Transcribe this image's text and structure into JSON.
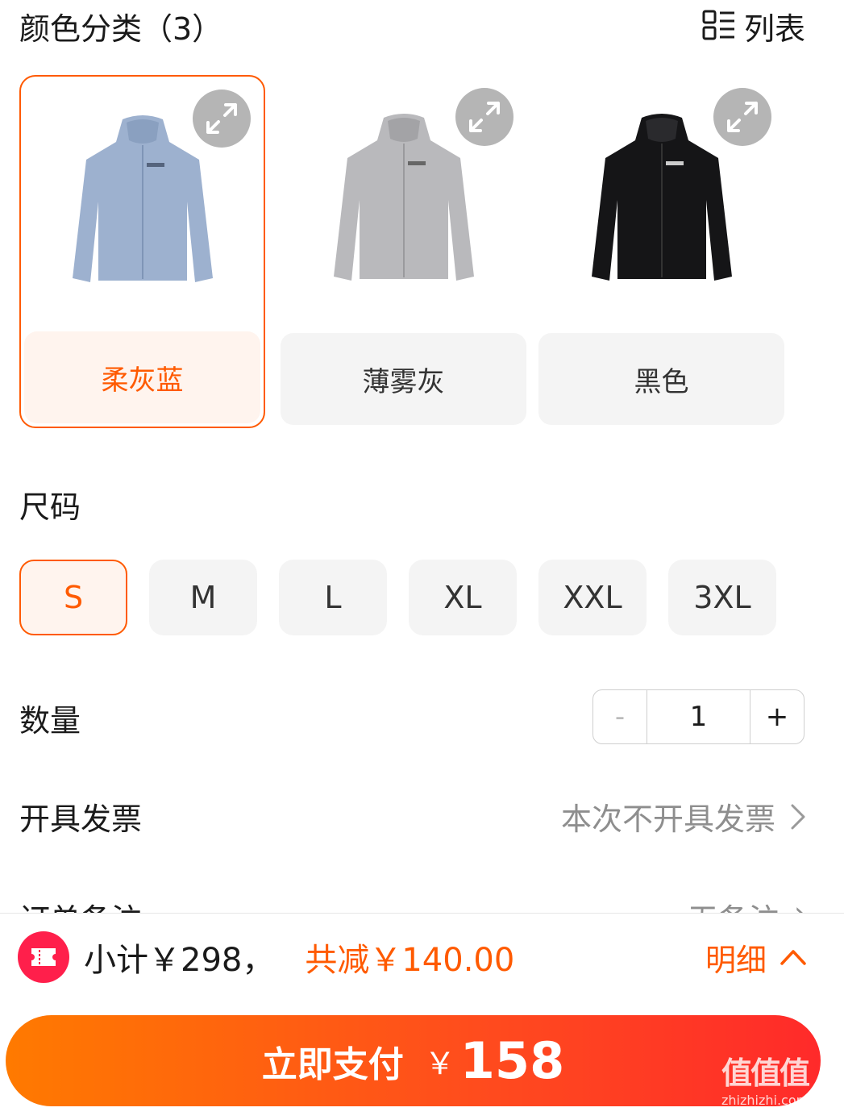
{
  "colors": {
    "title": "颜色分类（3）",
    "view_toggle": "列表",
    "items": [
      {
        "label": "柔灰蓝",
        "swatch": "#9db1cf",
        "selected": true
      },
      {
        "label": "薄雾灰",
        "swatch": "#b9b9bc",
        "selected": false
      },
      {
        "label": "黑色",
        "swatch": "#151517",
        "selected": false
      }
    ]
  },
  "size": {
    "title": "尺码",
    "options": [
      "S",
      "M",
      "L",
      "XL",
      "XXL",
      "3XL"
    ],
    "selected": "S"
  },
  "quantity": {
    "label": "数量",
    "minus": "-",
    "value": "1",
    "plus": "+"
  },
  "invoice": {
    "label": "开具发票",
    "value": "本次不开具发票"
  },
  "remark": {
    "label": "订单备注",
    "value": "无备注"
  },
  "summary": {
    "subtotal": "小计￥298，",
    "discount": "共减￥140.00",
    "detail": "明细"
  },
  "pay": {
    "label": "立即支付",
    "currency": "￥",
    "amount": "158"
  },
  "watermark": {
    "text": "值值值",
    "url": "zhizhizhi.com"
  },
  "theme": {
    "accent": "#ff5a00",
    "coupon": "#ff1f4b"
  }
}
